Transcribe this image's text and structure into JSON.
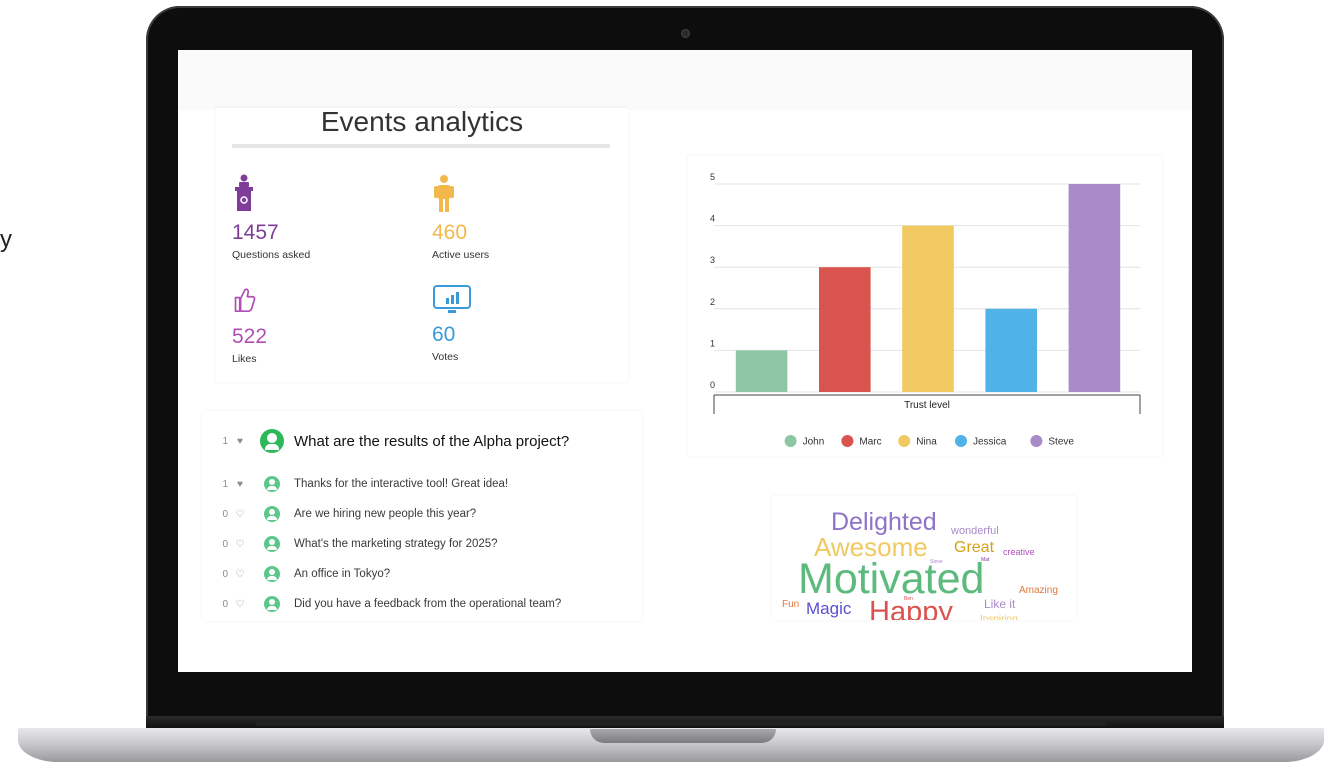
{
  "edge_text": "y",
  "analytics": {
    "title": "Events analytics",
    "stats": [
      {
        "value": "1457",
        "label": "Questions asked",
        "icon": "podium-icon",
        "color": "#7d3d98"
      },
      {
        "value": "460",
        "label": "Active users",
        "icon": "person-icon",
        "color": "#f2b84b"
      },
      {
        "value": "522",
        "label": "Likes",
        "icon": "thumbs-up-icon",
        "color": "#b04fb6"
      },
      {
        "value": "60",
        "label": "Votes",
        "icon": "poll-monitor-icon",
        "color": "#3a9ad9"
      }
    ]
  },
  "questions": [
    {
      "count": "1",
      "liked": true,
      "text": "What are the results of the Alpha project?",
      "featured": true
    },
    {
      "count": "1",
      "liked": true,
      "text": "Thanks for the interactive tool! Great idea!",
      "featured": false
    },
    {
      "count": "0",
      "liked": false,
      "text": "Are we hiring new people this year?",
      "featured": false
    },
    {
      "count": "0",
      "liked": false,
      "text": "What's the marketing strategy for 2025?",
      "featured": false
    },
    {
      "count": "0",
      "liked": false,
      "text": "An office in Tokyo?",
      "featured": false
    },
    {
      "count": "0",
      "liked": false,
      "text": "Did you have a feedback from the operational team?",
      "featured": false
    }
  ],
  "chart_data": {
    "type": "bar",
    "title": "",
    "xlabel": "Trust level",
    "ylabel": "",
    "ylim": [
      0,
      5
    ],
    "yticks": [
      "0",
      "1",
      "2",
      "3",
      "4",
      "5"
    ],
    "grid": true,
    "legend_position": "bottom",
    "series": [
      {
        "name": "John",
        "values": [
          1
        ],
        "color": "#8cc6a3"
      },
      {
        "name": "Marc",
        "values": [
          3
        ],
        "color": "#d9534f"
      },
      {
        "name": "Nina",
        "values": [
          4
        ],
        "color": "#f0c961"
      },
      {
        "name": "Jessica",
        "values": [
          2
        ],
        "color": "#4fb3e8"
      },
      {
        "name": "Steve",
        "values": [
          5
        ],
        "color": "#a98bc9"
      }
    ]
  },
  "word_cloud": {
    "words": [
      {
        "text": "Delighted",
        "color": "#8e74c7"
      },
      {
        "text": "wonderful",
        "color": "#a98bc9"
      },
      {
        "text": "Awesome",
        "color": "#f0c961"
      },
      {
        "text": "Great",
        "color": "#d4a017"
      },
      {
        "text": "creative",
        "color": "#b04fb6"
      },
      {
        "text": "Steve",
        "color": "#a98bc9"
      },
      {
        "text": "Mat",
        "color": "#7d3d98"
      },
      {
        "text": "Motivated",
        "color": "#5cba7d"
      },
      {
        "text": "Amazing",
        "color": "#e0783a"
      },
      {
        "text": "Fun",
        "color": "#e0783a"
      },
      {
        "text": "Magic",
        "color": "#5a4fcf"
      },
      {
        "text": "Ben",
        "color": "#d9534f"
      },
      {
        "text": "Happy",
        "color": "#d9534f"
      },
      {
        "text": "Like it",
        "color": "#a98bc9"
      },
      {
        "text": "Inspiring",
        "color": "#f0c961"
      }
    ]
  }
}
